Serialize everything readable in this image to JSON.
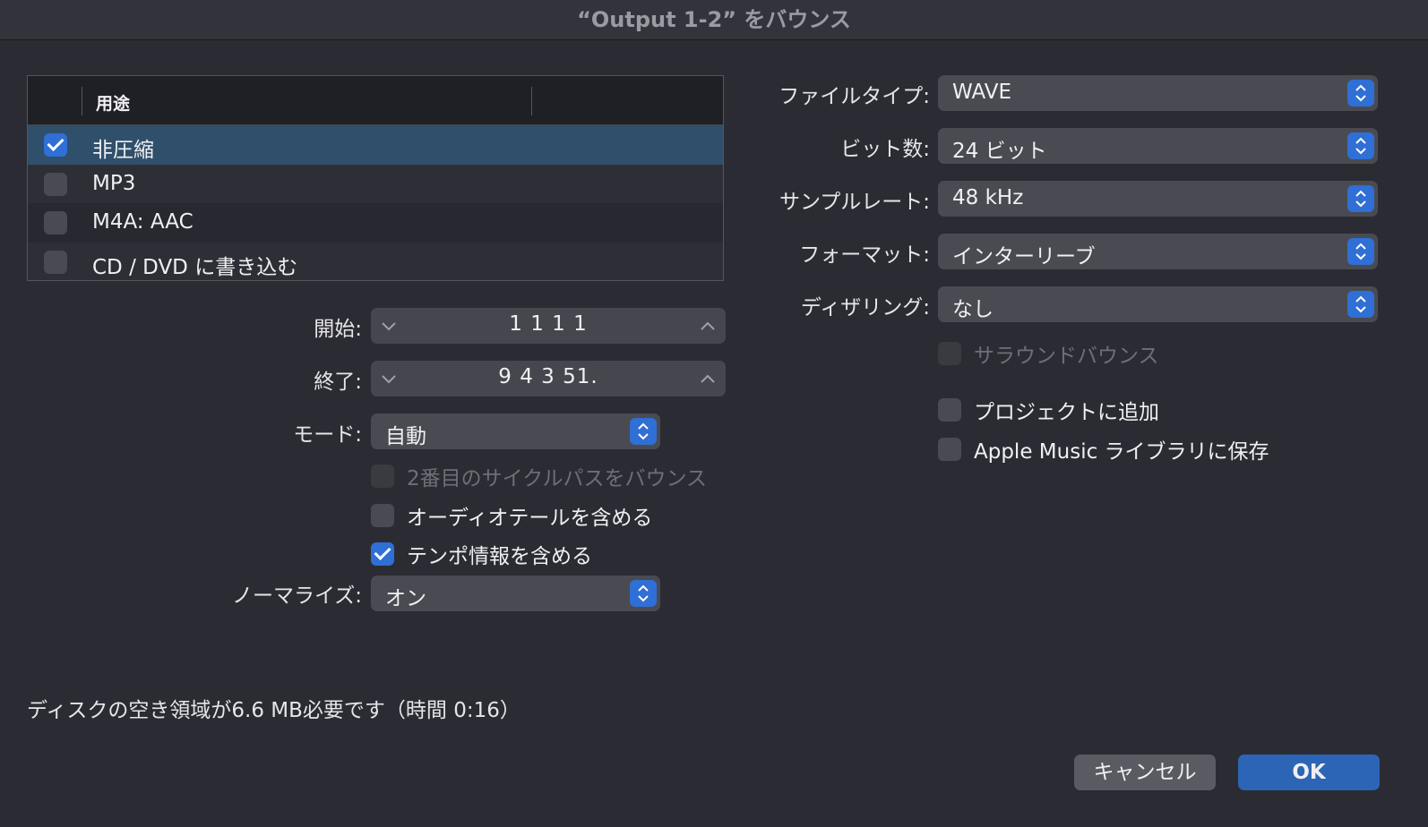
{
  "window": {
    "title": "“Output 1-2” をバウンス"
  },
  "destination_table": {
    "header": "用途",
    "rows": [
      {
        "label": "非圧縮",
        "checked": true
      },
      {
        "label": "MP3",
        "checked": false
      },
      {
        "label": "M4A: AAC",
        "checked": false
      },
      {
        "label": "CD / DVD に書き込む",
        "checked": false
      }
    ]
  },
  "range": {
    "start_label": "開始:",
    "start_value": "1 1 1   1",
    "end_label": "終了:",
    "end_value": "9 4 3  51."
  },
  "mode": {
    "label": "モード:",
    "value": "自動"
  },
  "options": {
    "second_cycle": "2番目のサイクルパスをバウンス",
    "audio_tail": "オーディオテールを含める",
    "tempo_info": "テンポ情報を含める"
  },
  "normalize": {
    "label": "ノーマライズ:",
    "value": "オン"
  },
  "format_settings": {
    "file_type_label": "ファイルタイプ:",
    "file_type": "WAVE",
    "bit_depth_label": "ビット数:",
    "bit_depth": "24 ビット",
    "sample_rate_label": "サンプルレート:",
    "sample_rate": "48 kHz",
    "format_label": "フォーマット:",
    "format": "インターリーブ",
    "dither_label": "ディザリング:",
    "dither": "なし",
    "surround_bounce": "サラウンドバウンス",
    "add_to_project": "プロジェクトに追加",
    "add_to_music": "Apple Music ライブラリに保存"
  },
  "footer": {
    "disk_info": "ディスクの空き領域が6.6 MB必要です（時間 0:16）"
  },
  "buttons": {
    "cancel": "キャンセル",
    "ok": "OK"
  },
  "colors": {
    "accent": "#2f6fd6",
    "selected_row": "#2f4f6b",
    "background": "#2b2c33"
  }
}
